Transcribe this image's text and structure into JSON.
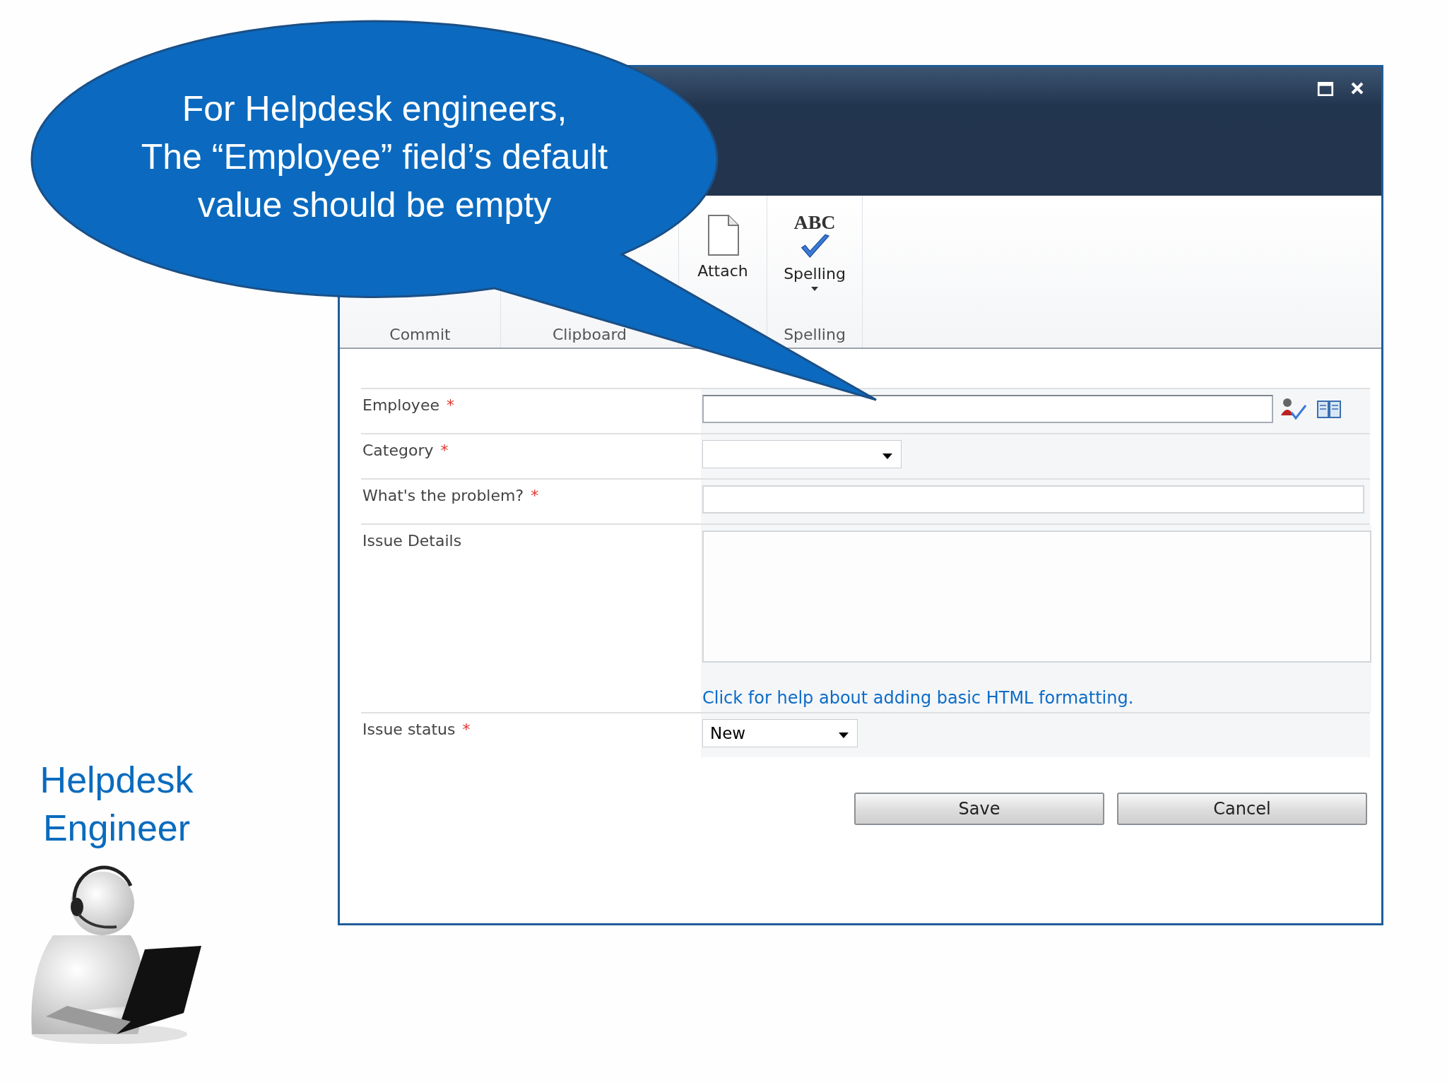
{
  "callout": {
    "text": "For Helpdesk engineers,\nThe “Employee” field’s default\nvalue should be empty"
  },
  "ribbon": {
    "groups": [
      {
        "label": "Commit"
      },
      {
        "label": "Clipboard"
      },
      {
        "buttons": [
          {
            "label": "Attach",
            "kind": "attach"
          }
        ]
      },
      {
        "label": "Spelling",
        "buttons": [
          {
            "label": "Spelling",
            "kind": "spelling",
            "icon_text": "ABC",
            "has_dropdown": true
          }
        ]
      }
    ]
  },
  "form": {
    "fields": [
      {
        "label": "Employee",
        "required_mark": "*",
        "kind": "people"
      },
      {
        "label": "Category",
        "required_mark": "*",
        "kind": "select"
      },
      {
        "label": "What's the problem?",
        "required_mark": "*",
        "kind": "text"
      },
      {
        "label": "Issue Details",
        "kind": "textarea",
        "help_link": "Click for help about adding basic HTML formatting."
      },
      {
        "label": "Issue status",
        "required_mark": "*",
        "kind": "select",
        "value": "New"
      }
    ]
  },
  "buttons": [
    "Save",
    "Cancel"
  ],
  "presenter": {
    "label": "Helpdesk Engineer"
  }
}
